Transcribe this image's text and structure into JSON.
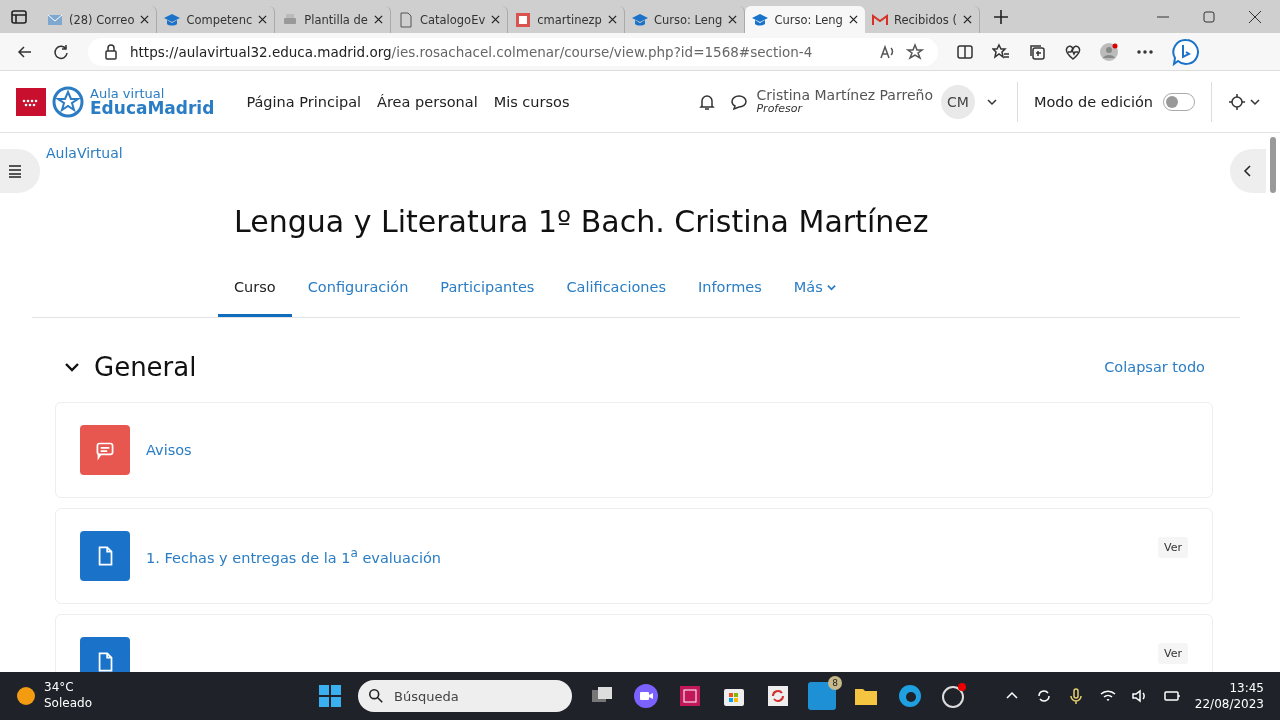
{
  "browser": {
    "tabs": [
      {
        "kind": "mail",
        "title": "(28) Correo",
        "selected": false
      },
      {
        "kind": "cap",
        "title": "Competenc",
        "selected": false
      },
      {
        "kind": "print",
        "title": "Plantilla de",
        "selected": false
      },
      {
        "kind": "doc",
        "title": "CatalogoEv",
        "selected": false
      },
      {
        "kind": "app",
        "title": "cmartinezp",
        "selected": false
      },
      {
        "kind": "cap",
        "title": "Curso: Leng",
        "selected": false
      },
      {
        "kind": "cap",
        "title": "Curso: Leng",
        "selected": true
      },
      {
        "kind": "gmail",
        "title": "Recibidos (",
        "selected": false
      }
    ],
    "url_host": "https://aulavirtual32.educa.madrid.org",
    "url_path": "/ies.rosachacel.colmenar/course/view.php?id=1568#section-4"
  },
  "site": {
    "logo_top": "Aula virtual",
    "logo_bottom": "EducaMadrid",
    "nav": [
      "Página Principal",
      "Área personal",
      "Mis cursos"
    ],
    "user_name": "Cristina Martínez Parreño",
    "user_role": "Profesor",
    "initials": "CM",
    "edit_mode_label": "Modo de edición",
    "edit_mode_on": false
  },
  "breadcrumb": "AulaVirtual",
  "course": {
    "title": "Lengua y Literatura 1º Bach. Cristina Martínez",
    "tabs": [
      {
        "label": "Curso",
        "selected": true
      },
      {
        "label": "Configuración",
        "selected": false
      },
      {
        "label": "Participantes",
        "selected": false
      },
      {
        "label": "Calificaciones",
        "selected": false
      },
      {
        "label": "Informes",
        "selected": false
      },
      {
        "label": "Más",
        "selected": false
      }
    ],
    "section": {
      "title": "General",
      "expanded": true
    },
    "collapse_all": "Colapsar todo",
    "activities": [
      {
        "kind": "forum",
        "name": "Avisos"
      },
      {
        "kind": "page",
        "name": "1. Fechas y entregas de la 1$^{a}$ evaluación",
        "action": "Ver"
      },
      {
        "kind": "page",
        "action": "Ver"
      }
    ]
  },
  "taskbar": {
    "temperature": "34°C",
    "weather": "Soleado",
    "search_placeholder": "Búsqueda",
    "mail_badge": "8",
    "time": "13:45",
    "date": "22/08/2023"
  }
}
